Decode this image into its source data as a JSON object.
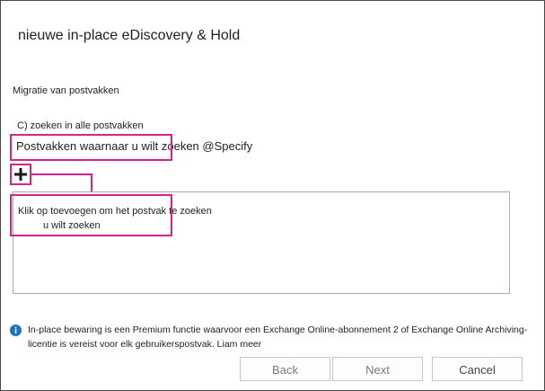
{
  "dialog": {
    "title": "nieuwe in-place eDiscovery & Hold",
    "section_label": "Migratie van postvakken",
    "radio_label": "C) zoeken in alle postvakken",
    "mailbox_label": "Postvakken waarnaar u wilt zoeken @Specify",
    "add_icon": "plus-icon",
    "hint_line1": "Klik op toevoegen om het postvak te zoeken",
    "hint_line2": "u wilt zoeken",
    "info_icon": "info-icon",
    "info_text": "In-place bewaring is een Premium functie waarvoor een Exchange Online-abonnement 2 of Exchange Online Archiving-licentie is vereist voor elk gebruikerspostvak. Liam meer",
    "highlight_color": "#d6248f"
  },
  "footer": {
    "back_label": "Back",
    "next_label": "Next",
    "cancel_label": "Cancel"
  }
}
